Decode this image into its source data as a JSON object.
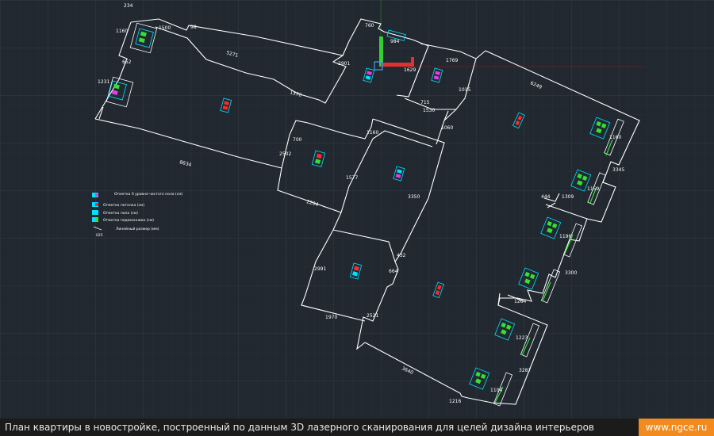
{
  "caption": {
    "text": "План квартиры в новостройке, построенный по данным 3D лазерного сканирования для целей дизайна интерьеров",
    "site": "www.ngce.ru"
  },
  "colors": {
    "background": "#212830",
    "grid": "#2c353f",
    "wall": "#ffffff",
    "cyan": "#00e0ff",
    "green": "#33e033",
    "magenta": "#e040e0",
    "red": "#ff2a2a",
    "badge": "#f28a1e"
  },
  "legend": [
    {
      "label": "Отметка 0 уровня чистого пола (см)",
      "icon": "floor-zero-mark"
    },
    {
      "label": "Отметка потолка (см)",
      "icon": "ceiling-mark"
    },
    {
      "label": "Отметка пола (см)",
      "icon": "floor-mark"
    },
    {
      "label": "Отметка подоконника (см)",
      "icon": "windowsill-mark"
    },
    {
      "label": "Линейный размер (мм)",
      "icon": "linear-dimension-mark",
      "sample": "025"
    }
  ],
  "dims": {
    "d234": "234",
    "d1160": "1160",
    "d98": "98",
    "d5271": "5271",
    "d1231": "1231",
    "d1576": "1576",
    "d8634": "8634",
    "d652": "652",
    "d1500": "1500",
    "d760": "760",
    "d984": "984",
    "d2901": "2901",
    "d1769": "1769",
    "d1629": "1629",
    "d715": "715",
    "d1530": "1530",
    "d1015": "1015",
    "d6249": "6249",
    "d1060": "1060",
    "d1160b": "1160",
    "d700": "700",
    "d2502": "2502",
    "d1577": "1577",
    "d2204": "2204",
    "d3350": "3350",
    "d1160c": "1160",
    "d3345": "3345",
    "d1159": "1159",
    "d444": "444",
    "d1309": "1309",
    "d432": "432",
    "d2991": "2991",
    "d664": "664",
    "d1970": "1970",
    "d2521": "2521",
    "d1196": "1196",
    "d3300": "3300",
    "d1264": "1264",
    "d1223": "1223",
    "d3640": "3640",
    "d3287": "3287",
    "d1104": "1104",
    "d1216": "1216"
  }
}
